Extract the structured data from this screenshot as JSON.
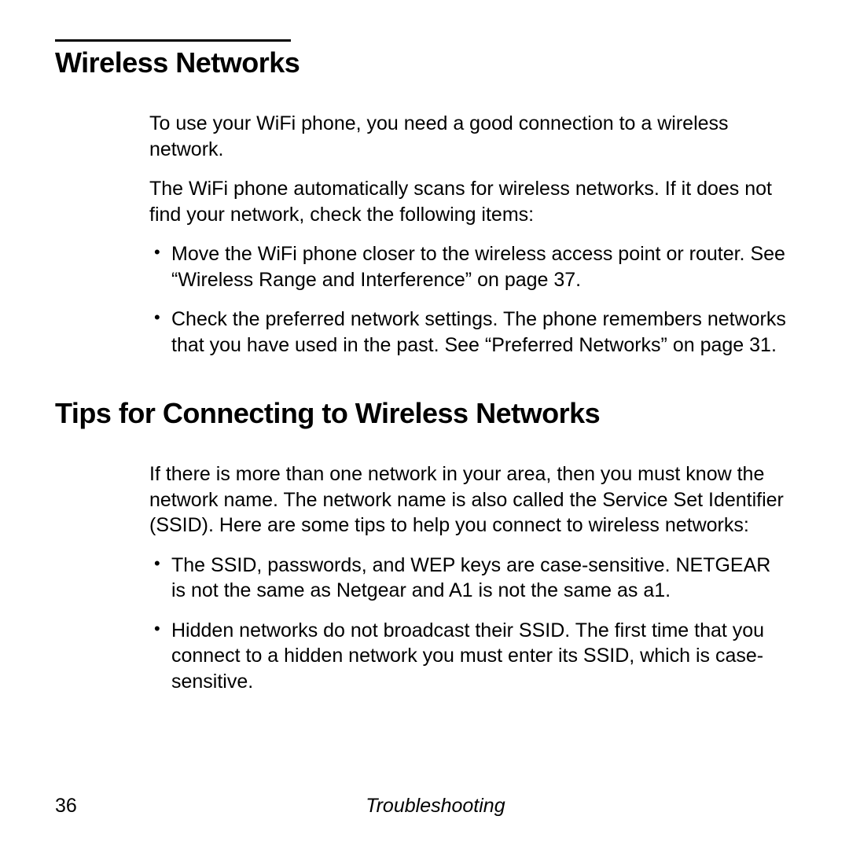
{
  "section1": {
    "heading": "Wireless Networks",
    "para1": "To use your WiFi phone, you need a good connection to a wireless network.",
    "para2": "The WiFi phone automatically scans for wireless networks. If it does not find your network, check the following items:",
    "bullets": [
      "Move the WiFi phone closer to the wireless access point or router. See “Wireless Range and Interference” on page 37.",
      "Check the preferred network settings. The phone remembers networks that you have used in the past. See “Preferred Networks” on page 31."
    ]
  },
  "section2": {
    "heading": "Tips for Connecting to Wireless Networks",
    "para1": "If there is more than one network in your area, then you must know the network name. The network name is also called the Service Set Identifier (SSID). Here are some tips to help you connect to wireless networks:",
    "bullets": [
      "The SSID, passwords, and WEP keys are case-sensitive. NETGEAR is not the same as Netgear and A1 is not the same as a1.",
      "Hidden networks do not broadcast their SSID. The first time that you connect to a hidden network you must enter its SSID, which is case-sensitive."
    ]
  },
  "footer": {
    "pageNumber": "36",
    "chapter": "Troubleshooting"
  }
}
